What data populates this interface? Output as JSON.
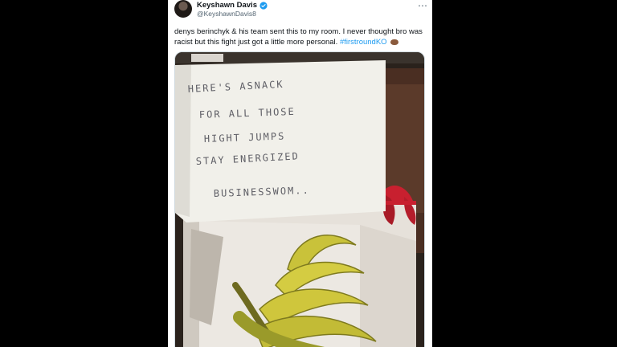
{
  "tweet": {
    "author": {
      "display_name": "Keyshawn Davis",
      "handle": "@KeyshawnDavis8",
      "verified": true
    },
    "text": "denys berinchyk & his team sent this to my room. I never thought bro was racist but this fight just got a little more personal.",
    "hashtag": "#firstroundKO",
    "emoji": "peanuts-emoji",
    "more_icon": "more-horizontal-icon"
  },
  "photo": {
    "note_lines": [
      "HERE'S ASNACK",
      "FOR ALL THOSE",
      "HIGHT JUMPS",
      "STAY ENERGIZED",
      "BUSINESSWOM.."
    ],
    "colors": {
      "wall": "#2a221c",
      "paper": "#f1f0ea",
      "box": "#ece8e2",
      "banana": "#c9c23a",
      "ribbon": "#c8202f"
    }
  }
}
